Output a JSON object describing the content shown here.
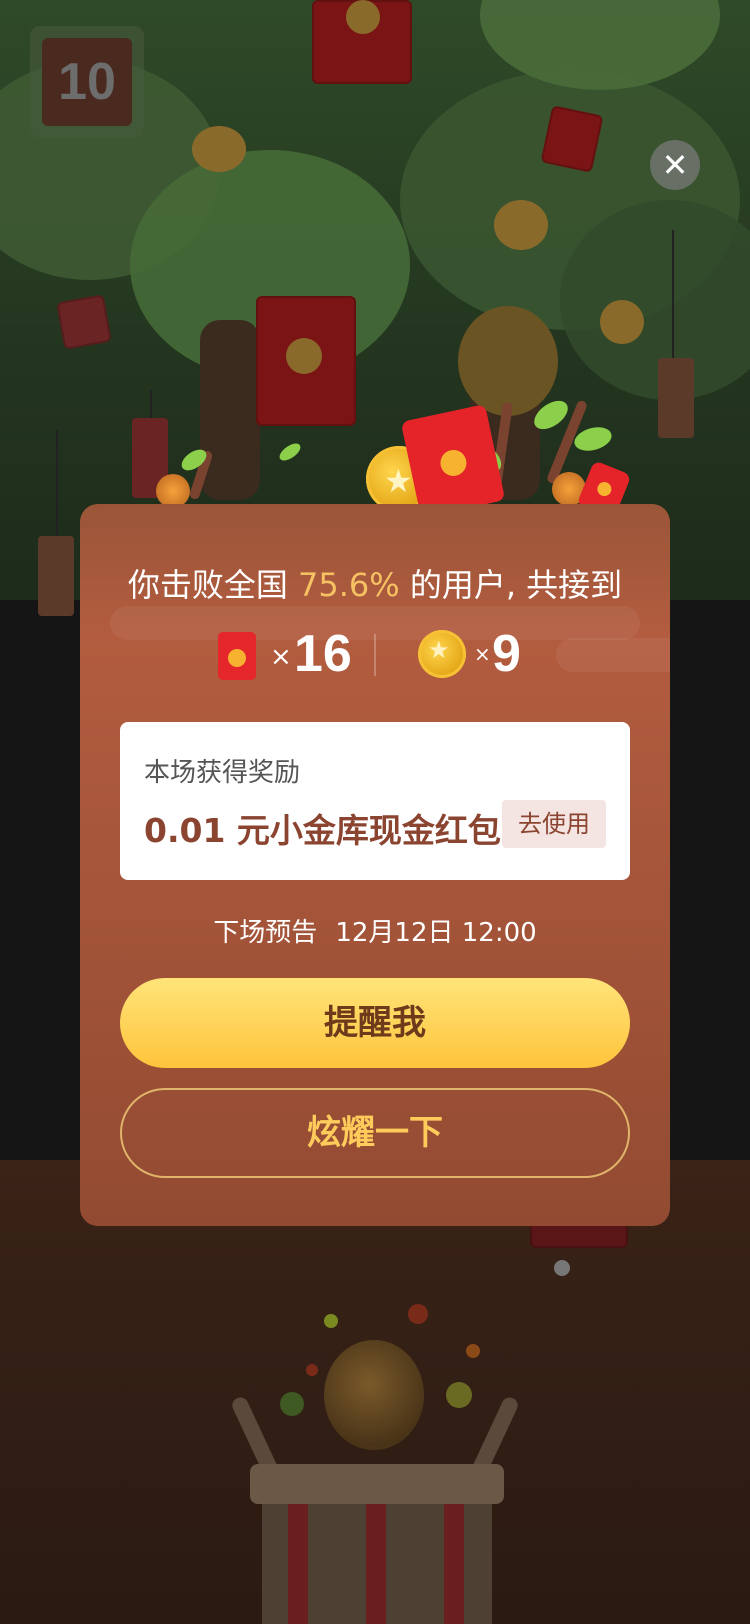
{
  "timer": {
    "value": "10"
  },
  "close": {
    "glyph": "✕"
  },
  "summary": {
    "prefix": "你击败全国",
    "percent": "75.6%",
    "suffix": "的用户, 共接到"
  },
  "stats": {
    "envelopes": {
      "times": "×",
      "count": "16"
    },
    "coins": {
      "times": "×",
      "count": "9"
    }
  },
  "reward": {
    "title": "本场获得奖励",
    "amount": "0.01 元小金库现金红包",
    "use_label": "去使用"
  },
  "next": {
    "label": "下场预告",
    "time": "12月12日 12:00"
  },
  "buttons": {
    "remind": "提醒我",
    "share": "炫耀一下"
  },
  "icons": {
    "star": "★"
  },
  "colors": {
    "card": "#b35c3f",
    "accent_percent": "#f6c163",
    "remind_button": "#ffd04e",
    "share_text": "#ffcc5c"
  }
}
